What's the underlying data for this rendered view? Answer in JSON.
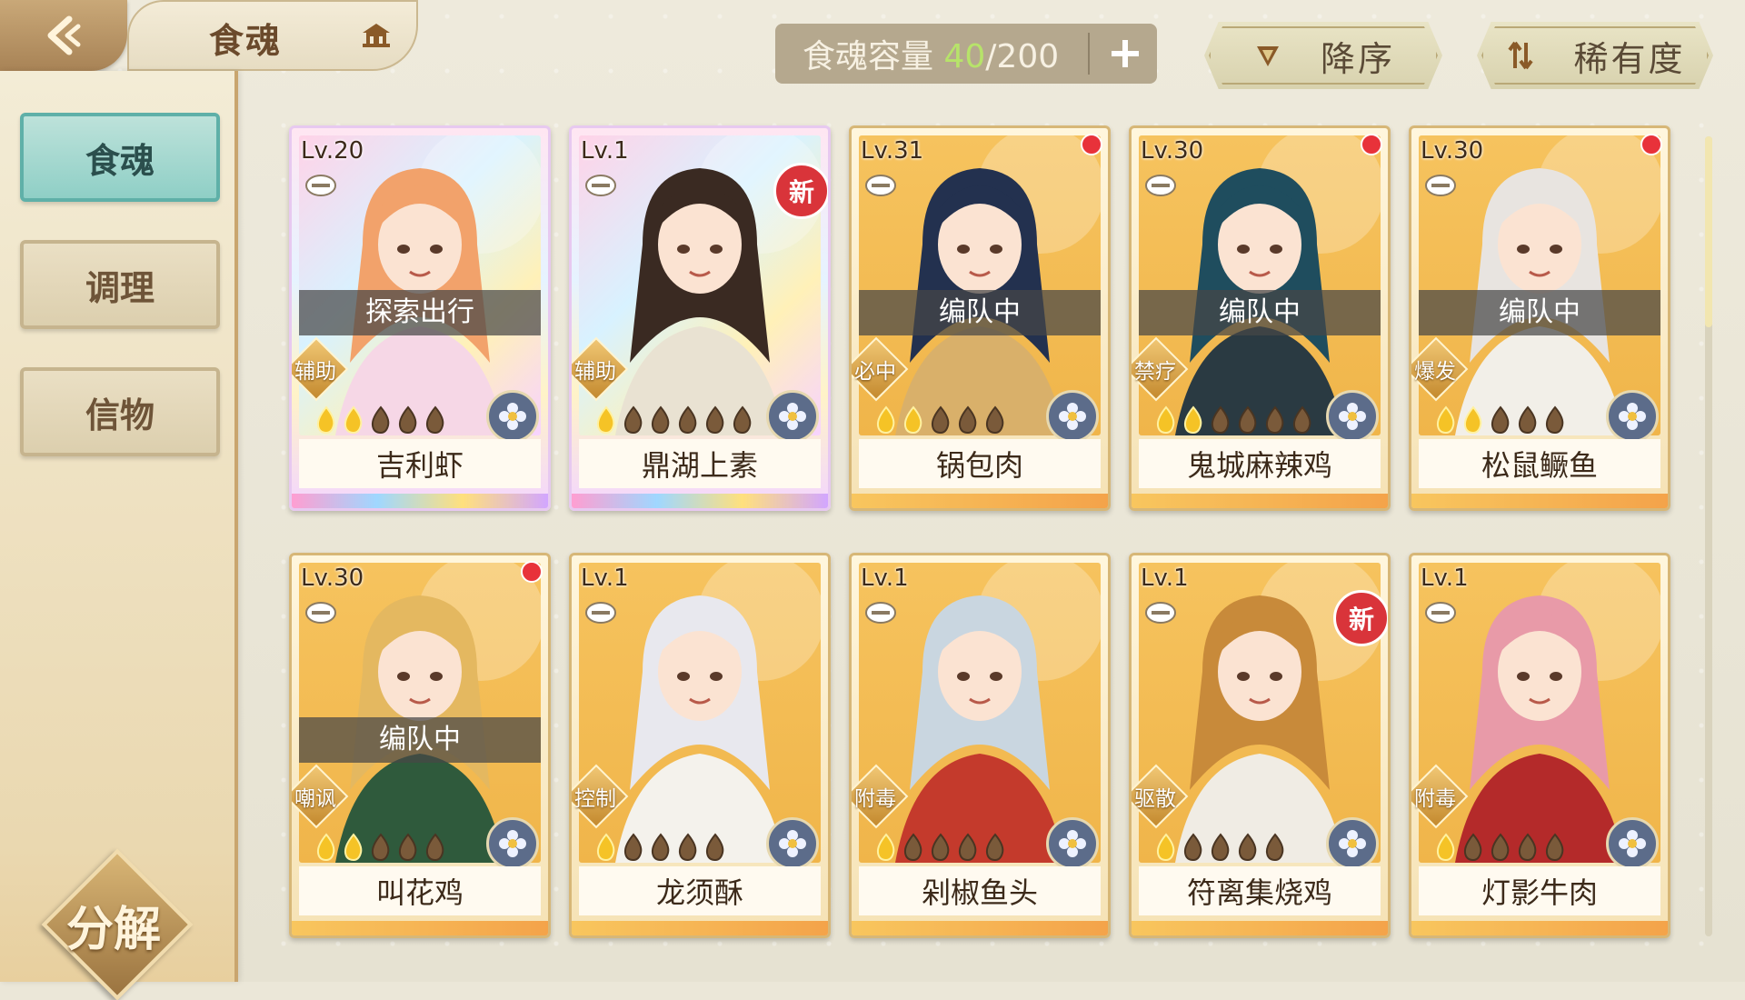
{
  "header": {
    "title": "食魂",
    "capacity_label": "食魂容量",
    "capacity_current": "40",
    "capacity_max": "/200",
    "sort_label": "降序",
    "filter_label": "稀有度"
  },
  "sidebar": {
    "tabs": [
      {
        "label": "食魂",
        "active": true
      },
      {
        "label": "调理",
        "active": false
      },
      {
        "label": "信物",
        "active": false
      }
    ],
    "decompose_label": "分解"
  },
  "cards": [
    {
      "level": "Lv.20",
      "name": "吉利虾",
      "status": "探索出行",
      "role": "辅助",
      "flames_lit": 2,
      "flames_total": 5,
      "rainbow": true,
      "red_dot": false,
      "new_badge": false
    },
    {
      "level": "Lv.1",
      "name": "鼎湖上素",
      "status": "",
      "role": "辅助",
      "flames_lit": 1,
      "flames_total": 6,
      "rainbow": true,
      "red_dot": false,
      "new_badge": true
    },
    {
      "level": "Lv.31",
      "name": "锅包肉",
      "status": "编队中",
      "role": "必中",
      "flames_lit": 2,
      "flames_total": 5,
      "rainbow": false,
      "red_dot": true,
      "new_badge": false
    },
    {
      "level": "Lv.30",
      "name": "鬼城麻辣鸡",
      "status": "编队中",
      "role": "禁疗",
      "flames_lit": 2,
      "flames_total": 6,
      "rainbow": false,
      "red_dot": true,
      "new_badge": false
    },
    {
      "level": "Lv.30",
      "name": "松鼠鳜鱼",
      "status": "编队中",
      "role": "爆发",
      "flames_lit": 2,
      "flames_total": 5,
      "rainbow": false,
      "red_dot": true,
      "new_badge": false
    },
    {
      "level": "Lv.30",
      "name": "叫花鸡",
      "status": "编队中",
      "role": "嘲讽",
      "flames_lit": 2,
      "flames_total": 5,
      "rainbow": false,
      "red_dot": true,
      "new_badge": false
    },
    {
      "level": "Lv.1",
      "name": "龙须酥",
      "status": "",
      "role": "控制",
      "flames_lit": 1,
      "flames_total": 5,
      "rainbow": false,
      "red_dot": false,
      "new_badge": false
    },
    {
      "level": "Lv.1",
      "name": "剁椒鱼头",
      "status": "",
      "role": "附毒",
      "flames_lit": 1,
      "flames_total": 5,
      "rainbow": false,
      "red_dot": false,
      "new_badge": false
    },
    {
      "level": "Lv.1",
      "name": "符离集烧鸡",
      "status": "",
      "role": "驱散",
      "flames_lit": 1,
      "flames_total": 5,
      "rainbow": false,
      "red_dot": false,
      "new_badge": true
    },
    {
      "level": "Lv.1",
      "name": "灯影牛肉",
      "status": "",
      "role": "附毒",
      "flames_lit": 1,
      "flames_total": 5,
      "rainbow": false,
      "red_dot": false,
      "new_badge": false
    }
  ],
  "new_badge_label": "新",
  "icons": {
    "back": "back-arrow-icon",
    "crown": "crown-icon",
    "add": "plus-icon",
    "sort": "triangle-down-icon",
    "filter": "swap-arrows-icon",
    "element": "flower-element-icon",
    "flame": "flame-icon",
    "bowl": "bowl-icon"
  },
  "colors": {
    "accent_teal": "#8fcfc6",
    "gold": "#d7b777",
    "capacity_number": "#b7e36a",
    "red_dot": "#e8323a"
  }
}
